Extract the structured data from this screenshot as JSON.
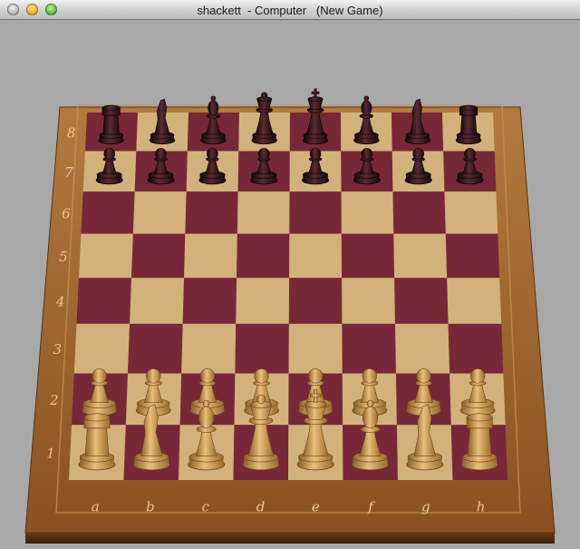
{
  "window": {
    "title": "shackett  - Computer   (New Game)"
  },
  "colors": {
    "background": "#a8a8a8",
    "light_square": "#d2b27a",
    "dark_square": "#762838",
    "frame_wood": "#8c5424",
    "white_pieces": "#c99a52",
    "black_pieces": "#2a1116"
  },
  "board": {
    "files": [
      "a",
      "b",
      "c",
      "d",
      "e",
      "f",
      "g",
      "h"
    ],
    "ranks": [
      "1",
      "2",
      "3",
      "4",
      "5",
      "6",
      "7",
      "8"
    ],
    "position": [
      [
        "R",
        "N",
        "B",
        "Q",
        "K",
        "B",
        "N",
        "R"
      ],
      [
        "P",
        "P",
        "P",
        "P",
        "P",
        "P",
        "P",
        "P"
      ],
      [
        "",
        "",
        "",
        "",
        "",
        "",
        "",
        ""
      ],
      [
        "",
        "",
        "",
        "",
        "",
        "",
        "",
        ""
      ],
      [
        "",
        "",
        "",
        "",
        "",
        "",
        "",
        ""
      ],
      [
        "",
        "",
        "",
        "",
        "",
        "",
        "",
        ""
      ],
      [
        "p",
        "p",
        "p",
        "p",
        "p",
        "p",
        "p",
        "p"
      ],
      [
        "r",
        "n",
        "b",
        "q",
        "k",
        "b",
        "n",
        "r"
      ]
    ]
  }
}
